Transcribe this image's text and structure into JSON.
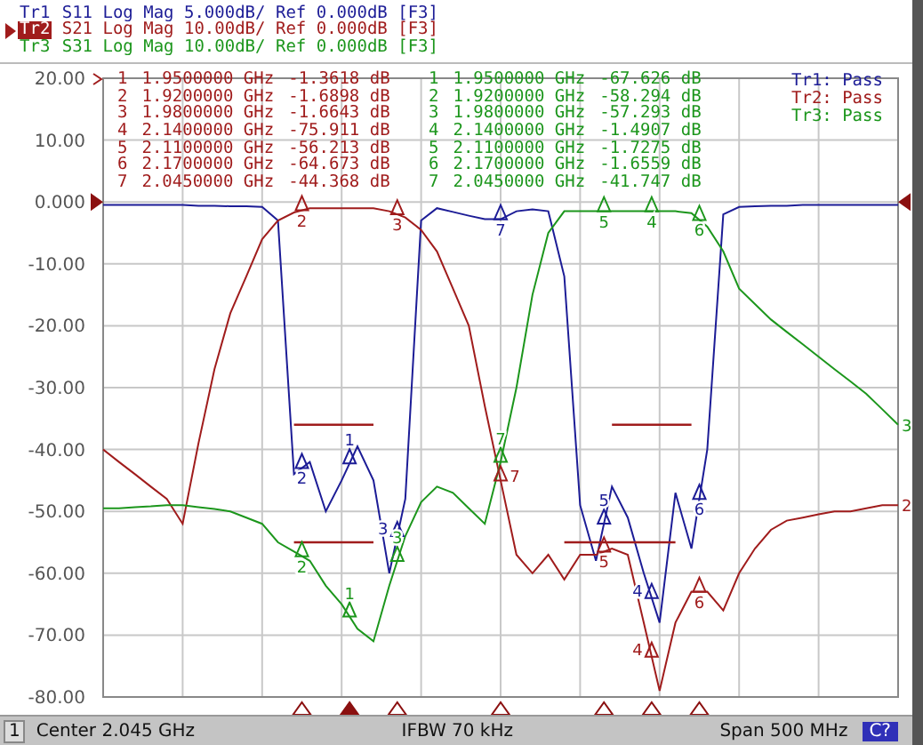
{
  "traces": [
    {
      "name": "Tr1",
      "settings": "S11 Log Mag 5.000dB/ Ref 0.000dB [F3]",
      "selected": false,
      "limit_label": "Tr1:",
      "limit_result": "Pass",
      "plot_markers": [
        {
          "label": "2"
        },
        {
          "label": "1"
        },
        {
          "label": "3"
        },
        {
          "label": "7"
        },
        {
          "label": "5"
        },
        {
          "label": "4"
        },
        {
          "label": "6"
        }
      ]
    },
    {
      "name": "Tr2",
      "settings": "S21 Log Mag 10.00dB/ Ref 0.000dB [F3]",
      "selected": true,
      "limit_label": "Tr2:",
      "limit_result": "Pass",
      "plot_markers": [
        {
          "label": "2"
        },
        {
          "label": "3"
        },
        {
          "label": "7"
        },
        {
          "label": "5"
        },
        {
          "label": "4"
        },
        {
          "label": "6"
        }
      ],
      "marker_table": [
        {
          "number": "1",
          "frequency": "1.9500000 GHz",
          "value": "-1.3618 dB",
          "selected": true
        },
        {
          "number": "2",
          "frequency": "1.9200000 GHz",
          "value": "-1.6898 dB",
          "selected": false
        },
        {
          "number": "3",
          "frequency": "1.9800000 GHz",
          "value": "-1.6643 dB",
          "selected": false
        },
        {
          "number": "4",
          "frequency": "2.1400000 GHz",
          "value": "-75.911 dB",
          "selected": false
        },
        {
          "number": "5",
          "frequency": "2.1100000 GHz",
          "value": "-56.213 dB",
          "selected": false
        },
        {
          "number": "6",
          "frequency": "2.1700000 GHz",
          "value": "-64.673 dB",
          "selected": false
        },
        {
          "number": "7",
          "frequency": "2.0450000 GHz",
          "value": "-44.368 dB",
          "selected": false
        }
      ]
    },
    {
      "name": "Tr3",
      "settings": "S31 Log Mag 10.00dB/ Ref 0.000dB [F3]",
      "selected": false,
      "limit_label": "Tr3:",
      "limit_result": "Pass",
      "plot_markers": [
        {
          "label": "2"
        },
        {
          "label": "1"
        },
        {
          "label": "3"
        },
        {
          "label": "7"
        },
        {
          "label": "5"
        },
        {
          "label": "4"
        },
        {
          "label": "6"
        }
      ],
      "marker_table": [
        {
          "number": "1",
          "frequency": "1.9500000 GHz",
          "value": "-67.626 dB"
        },
        {
          "number": "2",
          "frequency": "1.9200000 GHz",
          "value": "-58.294 dB"
        },
        {
          "number": "3",
          "frequency": "1.9800000 GHz",
          "value": "-57.293 dB"
        },
        {
          "number": "4",
          "frequency": "2.1400000 GHz",
          "value": "-1.4907 dB"
        },
        {
          "number": "5",
          "frequency": "2.1100000 GHz",
          "value": "-1.7275 dB"
        },
        {
          "number": "6",
          "frequency": "2.1700000 GHz",
          "value": "-1.6559 dB"
        },
        {
          "number": "7",
          "frequency": "2.0450000 GHz",
          "value": "-41.747 dB"
        }
      ]
    }
  ],
  "chart": {
    "chart_data": {
      "type": "line",
      "grid": true,
      "ylim": [
        -80,
        20
      ],
      "yticks": [
        {
          "value": 20,
          "label": "20.00"
        },
        {
          "value": 10,
          "label": "10.00"
        },
        {
          "value": 0,
          "label": "0.000"
        },
        {
          "value": -10,
          "label": "-10.00"
        },
        {
          "value": -20,
          "label": "-20.00"
        },
        {
          "value": -30,
          "label": "-30.00"
        },
        {
          "value": -40,
          "label": "-40.00"
        },
        {
          "value": -50,
          "label": "-50.00"
        },
        {
          "value": -60,
          "label": "-60.00"
        },
        {
          "value": -70,
          "label": "-70.00"
        },
        {
          "value": -80,
          "label": "-80.00"
        }
      ],
      "categories": [
        null,
        null,
        null,
        null,
        null,
        null,
        null,
        null,
        null,
        null,
        null,
        null,
        null,
        null,
        null,
        null,
        null,
        null,
        null,
        null,
        null,
        null,
        null,
        null,
        null,
        null,
        null,
        null,
        null,
        null,
        null,
        null,
        null,
        null,
        null,
        null,
        null,
        null,
        null,
        null,
        null,
        null,
        null,
        null,
        null,
        null,
        null,
        null,
        null,
        null,
        null
      ],
      "series": [
        {
          "color": "#1c1c96",
          "values": [
            -0.5,
            -0.5,
            -0.5,
            -0.5,
            -0.5,
            -0.5,
            -0.6,
            -0.6,
            -0.7,
            -0.7,
            -0.8,
            -3,
            -44,
            -42,
            -50,
            -45,
            -39.5,
            -45,
            -60,
            -48,
            -3,
            -1,
            -1.6,
            -2.2,
            -2.8,
            -2.8,
            -1.5,
            -1.2,
            -1.5,
            -12,
            -49,
            -58,
            -46,
            -51,
            -60,
            -68,
            -47,
            -56,
            -40,
            -2,
            -0.8,
            -0.7,
            -0.6,
            -0.6,
            -0.5,
            -0.5,
            -0.5,
            -0.5,
            -0.5,
            -0.5,
            -0.5
          ]
        },
        {
          "color": "#a01c1c",
          "values": [
            -40,
            -42,
            -44,
            -46,
            -48,
            -52,
            -39,
            -27,
            -18,
            -12,
            -6,
            -3,
            -1.7,
            -1,
            -1,
            -1,
            -1,
            -1,
            -1.5,
            -2.5,
            -4.5,
            -8,
            -14,
            -20,
            -33,
            -45,
            -57,
            -60,
            -57,
            -61,
            -57,
            -57,
            -56,
            -57,
            -68,
            -79,
            -68,
            -63,
            -63,
            -66,
            -60,
            -56,
            -53,
            -51.5,
            -51,
            -50.5,
            -50,
            -50,
            -49.5,
            -49,
            -49
          ]
        },
        {
          "color": "#1c961c",
          "values": [
            -49.5,
            -49.5,
            -49.3,
            -49.2,
            -49,
            -49,
            -49.3,
            -49.6,
            -50,
            -51,
            -52,
            -55,
            -56.5,
            -58,
            -62,
            -65,
            -69,
            -71,
            -62,
            -54,
            -48.5,
            -46,
            -47,
            -49.5,
            -52,
            -42,
            -30,
            -15,
            -5,
            -1.5,
            -1.5,
            -1.5,
            -1.5,
            -1.5,
            -1.5,
            -1.5,
            -1.5,
            -1.8,
            -4,
            -8,
            -14,
            -16.5,
            -19,
            -21,
            -23,
            -25,
            -27,
            -29,
            -31,
            -33.5,
            -36
          ]
        },
        {
          "color": "#a01c1c",
          "values": [
            null,
            null,
            null,
            null,
            null,
            null,
            null,
            null,
            null,
            null,
            null,
            null,
            -36,
            -36,
            -36,
            -36,
            -36,
            -36,
            null,
            null,
            null,
            null,
            null,
            null,
            null,
            null,
            null,
            null,
            null,
            null,
            null,
            null,
            -36,
            -36,
            -36,
            -36,
            -36,
            -36,
            null,
            null,
            null,
            null,
            null,
            null,
            null,
            null,
            null,
            null,
            null,
            null,
            null
          ]
        },
        {
          "color": "#a01c1c",
          "values": [
            null,
            null,
            null,
            null,
            null,
            null,
            null,
            null,
            null,
            null,
            null,
            null,
            -55,
            -55,
            -55,
            -55,
            -55,
            -55,
            null,
            null,
            null,
            null,
            null,
            null,
            null,
            null,
            null,
            null,
            null,
            -55,
            -55,
            -55,
            -55,
            -55,
            -55,
            -55,
            -55,
            null,
            null,
            null,
            null,
            null,
            null,
            null,
            null,
            null,
            null,
            null,
            null,
            null,
            null
          ]
        }
      ]
    },
    "trace_end_labels": [
      {
        "label": "3"
      },
      {
        "label": "2"
      }
    ]
  },
  "stimulus_markers": [
    {
      "selected": false
    },
    {
      "selected": true
    },
    {
      "selected": false
    },
    {
      "selected": false
    },
    {
      "selected": false
    },
    {
      "selected": false
    },
    {
      "selected": false
    }
  ],
  "status_bar": {
    "channel": "1",
    "center": "Center 2.045 GHz",
    "ifbw": "IFBW 70 kHz",
    "span": "Span 500 MHz",
    "badge": "C?"
  }
}
